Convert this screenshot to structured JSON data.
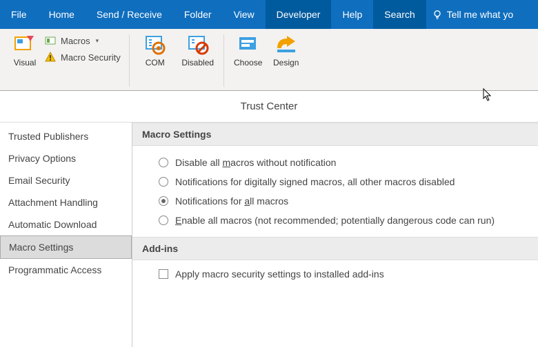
{
  "ribbon": {
    "tabs": [
      "File",
      "Home",
      "Send / Receive",
      "Folder",
      "View",
      "Developer",
      "Help",
      "Search"
    ],
    "active_tab": "Developer",
    "tell_me": "Tell me what yo"
  },
  "ribbon_content": {
    "visual_basic": "Visual",
    "macros": "Macros",
    "macro_security": "Macro Security",
    "com": "COM",
    "disabled": "Disabled",
    "choose": "Choose",
    "design": "Design"
  },
  "dialog": {
    "title": "Trust Center",
    "nav": [
      "Trusted Publishers",
      "Privacy Options",
      "Email Security",
      "Attachment Handling",
      "Automatic Download",
      "Macro Settings",
      "Programmatic Access"
    ],
    "active_nav": "Macro Settings",
    "macro_settings": {
      "header": "Macro Settings",
      "options": [
        {
          "pre": "Disable all ",
          "u": "m",
          "post": "acros without notification",
          "selected": false
        },
        {
          "pre": "Notifications for digitally si",
          "u": "g",
          "post": "ned macros, all other macros disabled",
          "selected": false
        },
        {
          "pre": "Notifications for ",
          "u": "a",
          "post": "ll macros",
          "selected": true
        },
        {
          "pre": "",
          "u": "E",
          "post": "nable all macros (not recommended; potentially dangerous code can run)",
          "selected": false
        }
      ]
    },
    "addins": {
      "header": "Add-ins",
      "checkbox": {
        "pre": "Apply macro security settings to installed add-ins",
        "checked": false
      }
    }
  }
}
